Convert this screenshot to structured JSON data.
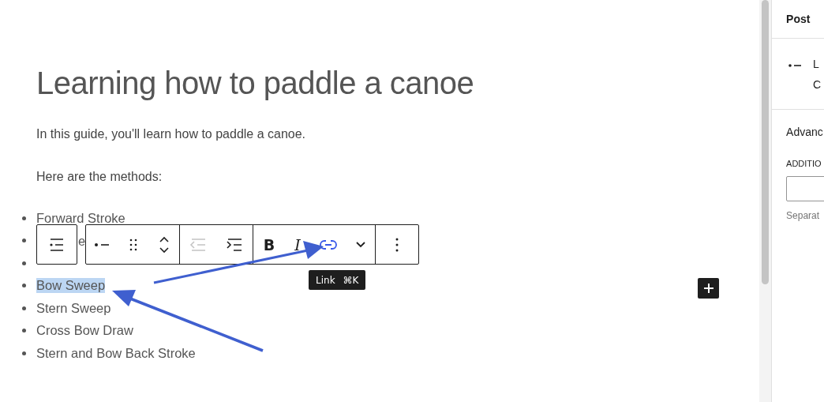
{
  "editor": {
    "title": "Learning how to paddle a canoe",
    "paragraphs": [
      "In this guide, you'll learn how to paddle a canoe.",
      "Here are the methods:"
    ],
    "list": [
      {
        "text": "Forward Stroke",
        "kind": "full"
      },
      {
        "text": "e",
        "kind": "covered"
      },
      {
        "kind": "hidden"
      },
      {
        "text": "Bow Sweep",
        "highlighted": true,
        "kind": "full"
      },
      {
        "text": "Stern Sweep",
        "kind": "full"
      },
      {
        "text": "Cross Bow Draw",
        "kind": "full"
      },
      {
        "text": "Stern and Bow Back Stroke",
        "kind": "full"
      }
    ]
  },
  "toolbar": {
    "groups": [
      [
        {
          "kind": "block-type",
          "disabled": false,
          "active": false
        }
      ],
      [
        {
          "kind": "bullet",
          "disabled": false,
          "active": false
        },
        {
          "kind": "drag",
          "disabled": false,
          "active": false
        },
        {
          "kind": "move",
          "disabled": false,
          "active": false
        }
      ],
      [
        {
          "kind": "outdent",
          "disabled": true,
          "active": false
        },
        {
          "kind": "indent",
          "disabled": false,
          "active": false
        }
      ],
      [
        {
          "kind": "bold",
          "label": "B",
          "disabled": false,
          "active": false
        },
        {
          "kind": "italic",
          "label": "I",
          "disabled": false,
          "active": false
        },
        {
          "kind": "link",
          "disabled": false,
          "active": true
        },
        {
          "kind": "more",
          "disabled": false,
          "active": false
        }
      ],
      [
        {
          "kind": "options",
          "disabled": false,
          "active": false
        }
      ]
    ],
    "tooltip": {
      "label": "Link",
      "shortcut": "⌘K"
    }
  },
  "sidebar": {
    "tab": "Post",
    "block": {
      "line_1": "L",
      "line_2": "C"
    },
    "advanced": {
      "heading": "Advanc",
      "field_label": "ADDITIO",
      "help": "Separat"
    }
  }
}
